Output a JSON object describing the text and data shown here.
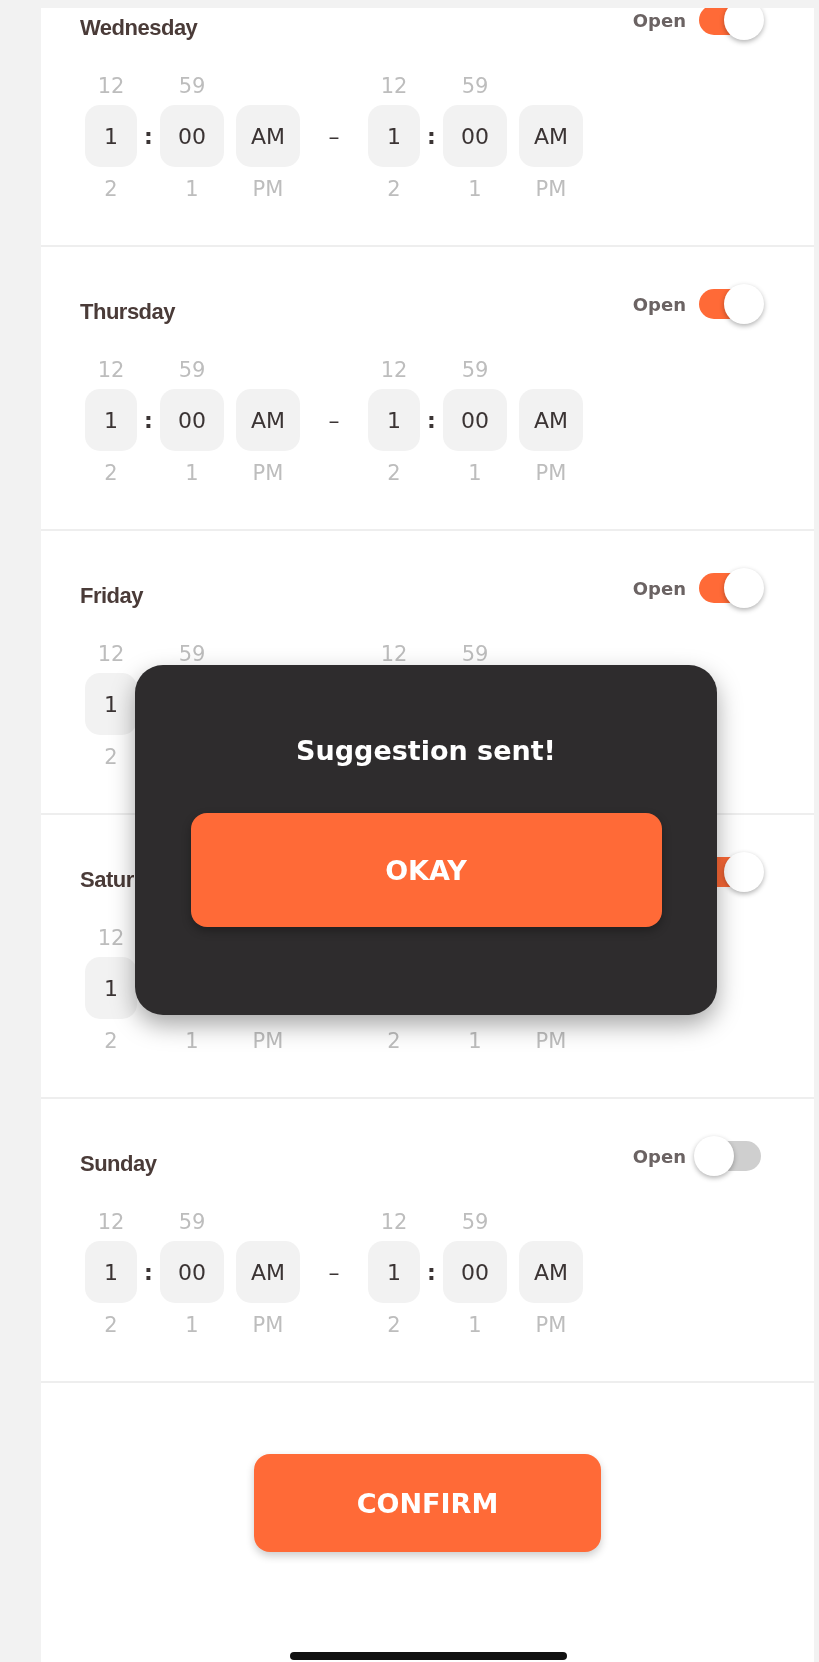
{
  "days": [
    {
      "name": "Wednesday",
      "open_label": "Open",
      "open": true,
      "start": {
        "hour": {
          "prev": "12",
          "value": "1",
          "next": "2"
        },
        "colon": ":",
        "minute": {
          "prev": "59",
          "value": "00",
          "next": "1"
        },
        "period": {
          "value": "AM",
          "next": "PM"
        }
      },
      "dash": "–",
      "end": {
        "hour": {
          "prev": "12",
          "value": "1",
          "next": "2"
        },
        "colon": ":",
        "minute": {
          "prev": "59",
          "value": "00",
          "next": "1"
        },
        "period": {
          "value": "AM",
          "next": "PM"
        }
      }
    },
    {
      "name": "Thursday",
      "open_label": "Open",
      "open": true,
      "start": {
        "hour": {
          "prev": "12",
          "value": "1",
          "next": "2"
        },
        "colon": ":",
        "minute": {
          "prev": "59",
          "value": "00",
          "next": "1"
        },
        "period": {
          "value": "AM",
          "next": "PM"
        }
      },
      "dash": "–",
      "end": {
        "hour": {
          "prev": "12",
          "value": "1",
          "next": "2"
        },
        "colon": ":",
        "minute": {
          "prev": "59",
          "value": "00",
          "next": "1"
        },
        "period": {
          "value": "AM",
          "next": "PM"
        }
      }
    },
    {
      "name": "Friday",
      "open_label": "Open",
      "open": true,
      "start": {
        "hour": {
          "prev": "12",
          "value": "1",
          "next": "2"
        },
        "minute": {
          "prev": "59"
        }
      },
      "end": {
        "hour": {
          "prev": "12"
        },
        "minute": {
          "prev": "59"
        }
      }
    },
    {
      "name": "Satur",
      "open": true,
      "start": {
        "hour": {
          "prev": "12",
          "value": "1",
          "next": "2"
        },
        "minute": {
          "next": "1"
        },
        "period": {
          "next": "PM"
        }
      },
      "end": {
        "hour": {
          "next": "2"
        },
        "minute": {
          "next": "1"
        },
        "period": {
          "next": "PM"
        }
      }
    },
    {
      "name": "Sunday",
      "open_label": "Open",
      "open": false,
      "start": {
        "hour": {
          "prev": "12",
          "value": "1",
          "next": "2"
        },
        "colon": ":",
        "minute": {
          "prev": "59",
          "value": "00",
          "next": "1"
        },
        "period": {
          "value": "AM",
          "next": "PM"
        }
      },
      "dash": "–",
      "end": {
        "hour": {
          "prev": "12",
          "value": "1",
          "next": "2"
        },
        "colon": ":",
        "minute": {
          "prev": "59",
          "value": "00",
          "next": "1"
        },
        "period": {
          "value": "AM",
          "next": "PM"
        }
      }
    }
  ],
  "modal": {
    "title": "Suggestion sent!",
    "button": "OKAY"
  },
  "confirm_button": "CONFIRM"
}
